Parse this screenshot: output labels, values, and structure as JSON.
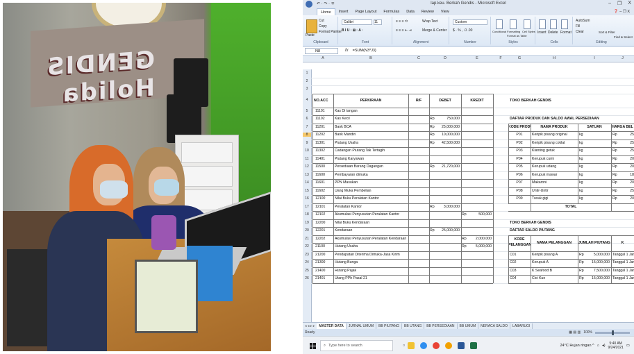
{
  "photo": {
    "banner_text": "GENDIS\nHolida"
  },
  "excel": {
    "title": "lap.keu. Berkah Gendis - Microsoft Excel",
    "quick_access": "↶ · ↷ · ∓",
    "window_controls": [
      "–",
      "❐",
      "X"
    ],
    "ribbon_tabs": [
      "Home",
      "Insert",
      "Page Layout",
      "Formulas",
      "Data",
      "Review",
      "View"
    ],
    "ribbon_right": "❓ – ❐ X",
    "groups": {
      "clipboard": {
        "label": "Clipboard",
        "paste": "Paste",
        "cut": "Cut",
        "copy": "Copy",
        "format_painter": "Format Painter"
      },
      "font": {
        "label": "Font",
        "font_name": "Calibri",
        "font_size": "11",
        "btns": "B  I  U  ·  ⊞  ·  A  ·"
      },
      "alignment": {
        "label": "Alignment",
        "wrap": "Wrap Text",
        "merge": "Merge & Center"
      },
      "number": {
        "label": "Number",
        "format": "Custom",
        "fmt": "$ · %  ,  .0 .00"
      },
      "styles": {
        "label": "Styles",
        "cond": "Conditional Formatting",
        "table": "Format as Table",
        "cell": "Cell Styles"
      },
      "cells": {
        "label": "Cells",
        "insert": "Insert",
        "delete": "Delete",
        "format": "Format"
      },
      "editing": {
        "label": "Editing",
        "autosum": "AutoSum",
        "fill": "Fill",
        "clear": "Clear",
        "sort": "Sort & Filter",
        "find": "Find & Select"
      }
    },
    "name_box": "N8",
    "fx": "fx",
    "formula": "=SUM(N3*J3)",
    "columns": [
      "A",
      "B",
      "C",
      "D",
      "E",
      "F",
      "G",
      "H",
      "I",
      "J"
    ],
    "row_numbers": [
      "1",
      "2",
      "3",
      "4",
      "5",
      "6",
      "7",
      "8",
      "9",
      "10",
      "11",
      "12",
      "13",
      "14",
      "15",
      "16",
      "17",
      "18",
      "19",
      "20",
      "21",
      "22",
      "23",
      "24",
      "25",
      "26"
    ],
    "left_table": {
      "headers": {
        "acc": "NO.ACC",
        "perkiraan": "PERKIRAAN",
        "rs": "R/F",
        "debet": "DEBET",
        "kredit": "KREDIT"
      },
      "rows": [
        {
          "acc": "11101",
          "name": "Kas Di tangan",
          "d_cur": "",
          "debet": "",
          "k_cur": "",
          "kredit": ""
        },
        {
          "acc": "11102",
          "name": "Kas Kecil",
          "d_cur": "Rp",
          "debet": "750,000",
          "k_cur": "",
          "kredit": ""
        },
        {
          "acc": "11201",
          "name": "Bank BCA",
          "d_cur": "Rp",
          "debet": "25,000,000",
          "k_cur": "",
          "kredit": ""
        },
        {
          "acc": "11202",
          "name": "Bank Mandiri",
          "d_cur": "Rp",
          "debet": "10,000,000",
          "k_cur": "",
          "kredit": ""
        },
        {
          "acc": "11301",
          "name": "Piutang Usaha",
          "d_cur": "Rp",
          "debet": "42,500,000",
          "k_cur": "",
          "kredit": ""
        },
        {
          "acc": "11302",
          "name": "Cadangan Piutang Tak Tertagih",
          "d_cur": "",
          "debet": "",
          "k_cur": "",
          "kredit": ""
        },
        {
          "acc": "11401",
          "name": "Piutang Karyawan",
          "d_cur": "",
          "debet": "",
          "k_cur": "",
          "kredit": ""
        },
        {
          "acc": "11500",
          "name": "Persediaan Barang Dagangan",
          "d_cur": "Rp",
          "debet": "21,720,000",
          "k_cur": "",
          "kredit": ""
        },
        {
          "acc": "11600",
          "name": "Pembayaran dimuka",
          "d_cur": "",
          "debet": "",
          "k_cur": "",
          "kredit": ""
        },
        {
          "acc": "11601",
          "name": "PPN Masukan",
          "d_cur": "",
          "debet": "",
          "k_cur": "",
          "kredit": ""
        },
        {
          "acc": "11602",
          "name": "Uang Muka Pembelian",
          "d_cur": "",
          "debet": "",
          "k_cur": "",
          "kredit": ""
        },
        {
          "acc": "12100",
          "name": "Nilai Buku Peralatan Kantor",
          "d_cur": "",
          "debet": "",
          "k_cur": "",
          "kredit": ""
        },
        {
          "acc": "12101",
          "name": "Peralatan Kantor",
          "d_cur": "Rp",
          "debet": "3,000,000",
          "k_cur": "",
          "kredit": ""
        },
        {
          "acc": "12102",
          "name": "Akumulasi Penyusutan Peralatan Kantor",
          "d_cur": "",
          "debet": "",
          "k_cur": "Rp",
          "kredit": "500,000"
        },
        {
          "acc": "12200",
          "name": "Nilai Buku Kendaraan",
          "d_cur": "",
          "debet": "",
          "k_cur": "",
          "kredit": ""
        },
        {
          "acc": "12201",
          "name": "Kendaraan",
          "d_cur": "Rp",
          "debet": "25,000,000",
          "k_cur": "",
          "kredit": ""
        },
        {
          "acc": "12202",
          "name": "Akumulasi Penyusutan Peralatan Kendaraan",
          "d_cur": "",
          "debet": "",
          "k_cur": "Rp",
          "kredit": "2,000,000"
        },
        {
          "acc": "21100",
          "name": "Hutang Usaha",
          "d_cur": "",
          "debet": "",
          "k_cur": "Rp",
          "kredit": "5,000,000"
        },
        {
          "acc": "21200",
          "name": "Pendapatan Diterima Dimuka-Jasa Kirim",
          "d_cur": "",
          "debet": "",
          "k_cur": "",
          "kredit": ""
        },
        {
          "acc": "21300",
          "name": "Hutang Bunga",
          "d_cur": "",
          "debet": "",
          "k_cur": "",
          "kredit": ""
        },
        {
          "acc": "21400",
          "name": "Hutang Pajak",
          "d_cur": "",
          "debet": "",
          "k_cur": "",
          "kredit": ""
        },
        {
          "acc": "21401",
          "name": "Utang PPh Pasal 21",
          "d_cur": "",
          "debet": "",
          "k_cur": "",
          "kredit": ""
        }
      ]
    },
    "product_section": {
      "store": "TOKO BERKAH GENDIS",
      "title": "DAFTAR PRODUK DAN SALDO AWAL PERSEDIAAN",
      "headers": {
        "kode": "KODE PRODUK",
        "nama": "NAMA PRODUK",
        "satuan": "SATUAN",
        "harga": "HARGA BEL"
      },
      "rows": [
        {
          "kode": "P01",
          "nama": "Keripik pisang original",
          "satuan": "kg",
          "cur": "Rp",
          "harga": "25"
        },
        {
          "kode": "P02",
          "nama": "Keripik pisang coklat",
          "satuan": "kg",
          "cur": "Rp",
          "harga": "25"
        },
        {
          "kode": "P03",
          "nama": "Klanting getuk",
          "satuan": "kg",
          "cur": "Rp",
          "harga": "25"
        },
        {
          "kode": "P04",
          "nama": "Kerupuk cumi",
          "satuan": "kg",
          "cur": "Rp",
          "harga": "20"
        },
        {
          "kode": "P05",
          "nama": "Kerupuk udang",
          "satuan": "kg",
          "cur": "Rp",
          "harga": "20"
        },
        {
          "kode": "P06",
          "nama": "Kerupuk mawar",
          "satuan": "kg",
          "cur": "Rp",
          "harga": "18"
        },
        {
          "kode": "P07",
          "nama": "Makaroni",
          "satuan": "kg",
          "cur": "Rp",
          "harga": "20"
        },
        {
          "kode": "P08",
          "nama": "Untir-Untir",
          "satuan": "kg",
          "cur": "Rp",
          "harga": "25"
        },
        {
          "kode": "P09",
          "nama": "Tusuk gigi",
          "satuan": "kg",
          "cur": "Rp",
          "harga": "20"
        }
      ],
      "total": "TOTAL"
    },
    "receivable_section": {
      "store": "TOKO BERKAH GENDIS",
      "title": "DAFTAR SALDO PIUTANG",
      "headers": {
        "kode": "KODE PELANGGAN",
        "nama": "NAMA PELANGGAN",
        "jumlah": "JUMLAH PIUTANG",
        "k": "K"
      },
      "rows": [
        {
          "kode": "C01",
          "nama": "Keripik pisang A",
          "cur": "Rp",
          "jumlah": "5,000,000",
          "tgl": "Tanggal 1 Janua"
        },
        {
          "kode": "C02",
          "nama": "Kerupuk A",
          "cur": "Rp",
          "jumlah": "15,000,000",
          "tgl": "Tanggal 1 Janua"
        },
        {
          "kode": "C03",
          "nama": "K Seafood B",
          "cur": "Rp",
          "jumlah": "7,500,000",
          "tgl": "Tanggal 1 Janua"
        },
        {
          "kode": "C04",
          "nama": "Cici Kue",
          "cur": "Rp",
          "jumlah": "15,000,000",
          "tgl": "Tanggal 1 Janua"
        }
      ]
    },
    "sheet_tabs": [
      "MASTER DATA",
      "JURNAL UMUM",
      "BB PIUTANG",
      "BB UTANG",
      "BB PERSEDIAAN",
      "BB UMUM",
      "NERACA SALDO",
      "LABARUGI"
    ],
    "sheet_nav": "◂ ◂ ▸ ▸",
    "status": "Ready",
    "zoom": "100%"
  },
  "taskbar": {
    "search_placeholder": "Type here to search",
    "weather": "24°C  Hujan ringan  ^",
    "time": "5:40 AM",
    "date": "9/24/2021"
  }
}
